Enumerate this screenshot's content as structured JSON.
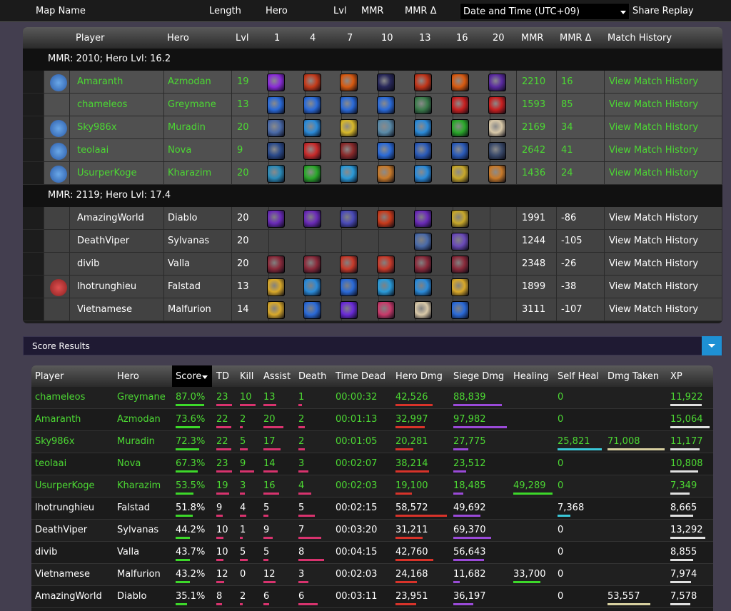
{
  "topbar": {
    "map_name": "Map Name",
    "length": "Length",
    "hero": "Hero",
    "lvl": "Lvl",
    "mmr": "MMR",
    "mmr_delta": "MMR Δ",
    "date_select": "Date and Time (UTC+09)",
    "share_replay": "Share Replay"
  },
  "match_table": {
    "columns": [
      "Player",
      "Hero",
      "Lvl",
      "1",
      "4",
      "7",
      "10",
      "13",
      "16",
      "20",
      "MMR",
      "MMR Δ",
      "Match History"
    ],
    "teams": [
      {
        "label": "MMR: 2010; Hero Lvl: 16.2",
        "winner": true,
        "players": [
          {
            "player": "Amaranth",
            "hero": "Azmodan",
            "lvl": "19",
            "mmr": "2210",
            "mmr_delta": "16",
            "history": "View Match History",
            "badge": "hex-blue-badge",
            "talents": [
              "#8a2bd8",
              "#c43a1a",
              "#d85a10",
              "#28285a",
              "#c03418",
              "#d85a10",
              "#5a2aa0"
            ]
          },
          {
            "player": "chameleos",
            "hero": "Greymane",
            "lvl": "13",
            "mmr": "1593",
            "mmr_delta": "85",
            "history": "View Match History",
            "badge": "",
            "talents": [
              "#2a6ad8",
              "#2a6ad8",
              "#2a6ad8",
              "#2a6ad8",
              "#3a7a4a",
              "#c82020",
              "#c82020"
            ]
          },
          {
            "player": "Sky986x",
            "hero": "Muradin",
            "lvl": "20",
            "mmr": "2169",
            "mmr_delta": "34",
            "history": "View Match History",
            "badge": "shield-blue-badge",
            "talents": [
              "#4a6aa8",
              "#2a8ad8",
              "#d8b82a",
              "#5a8aa8",
              "#2a8ad8",
              "#2aa82a",
              "#d8c8a8"
            ]
          },
          {
            "player": "teolaai",
            "hero": "Nova",
            "lvl": "9",
            "mmr": "2642",
            "mmr_delta": "41",
            "history": "View Match History",
            "badge": "shield-blue-badge",
            "talents": [
              "#2a4a8a",
              "#c82a2a",
              "#8a2a2a",
              "#2a6ad8",
              "#2a5ab8",
              "#2a5ab8",
              "#3a4a6a"
            ]
          },
          {
            "player": "UsurperKoge",
            "hero": "Kharazim",
            "lvl": "20",
            "mmr": "1436",
            "mmr_delta": "24",
            "history": "View Match History",
            "badge": "shield-blue-badge",
            "talents": [
              "#2a8ab8",
              "#2aa82a",
              "#2a9ad8",
              "#c87a2a",
              "#2a8ad8",
              "#c8a82a",
              "#c87a2a"
            ]
          }
        ]
      },
      {
        "label": "MMR: 2119; Hero Lvl: 17.4",
        "winner": false,
        "players": [
          {
            "player": "AmazingWorld",
            "hero": "Diablo",
            "lvl": "20",
            "mmr": "1991",
            "mmr_delta": "-86",
            "history": "View Match History",
            "badge": "",
            "talents": [
              "#6a2ab8",
              "#6a2ab8",
              "#4a4ab8",
              "#c83a1a",
              "#6a2ab8",
              "#c8a82a"
            ]
          },
          {
            "player": "DeathViper",
            "hero": "Sylvanas",
            "lvl": "20",
            "mmr": "1244",
            "mmr_delta": "-105",
            "history": "View Match History",
            "badge": "",
            "talents": [
              "",
              "",
              "",
              "",
              "#4a6aa8",
              "#6a4ab8"
            ]
          },
          {
            "player": "divib",
            "hero": "Valla",
            "lvl": "20",
            "mmr": "2348",
            "mmr_delta": "-26",
            "history": "View Match History",
            "badge": "",
            "talents": [
              "#8a2a3a",
              "#8a2a3a",
              "#c83a2a",
              "#c83a2a",
              "#8a2a3a",
              "#8a2a3a"
            ]
          },
          {
            "player": "lhotrunghieu",
            "hero": "Falstad",
            "lvl": "13",
            "mmr": "1899",
            "mmr_delta": "-38",
            "history": "View Match History",
            "badge": "red-wings-badge",
            "talents": [
              "#d8a82a",
              "#2a8ad8",
              "#2a6ad8",
              "#2a9ad8",
              "#2a8ad8",
              "#d8a82a"
            ]
          },
          {
            "player": "Vietnamese",
            "hero": "Malfurion",
            "lvl": "14",
            "mmr": "3111",
            "mmr_delta": "-107",
            "history": "View Match History",
            "badge": "",
            "talents": [
              "#d8a82a",
              "#2a6ad8",
              "#6a2ad8",
              "#c83a6a",
              "#d8c8a8",
              "#2a6ad8"
            ]
          }
        ]
      }
    ]
  },
  "score_results": {
    "title": "Score Results",
    "columns": [
      "Player",
      "Hero",
      "Score",
      "TD",
      "Kill",
      "Assist",
      "Death",
      "Time Dead",
      "Hero Dmg",
      "Siege Dmg",
      "Healing",
      "Self Heal",
      "Dmg Taken",
      "XP"
    ],
    "rows": [
      {
        "player": "chameleos",
        "hero": "Greymane",
        "score": "87.0%",
        "td": "23",
        "kill": "10",
        "assist": "13",
        "death": "1",
        "time_dead": "00:00:32",
        "hero_dmg": "42,526",
        "siege_dmg": "88,839",
        "healing": "",
        "self_heal": "0",
        "dmg_taken": "",
        "xp": "11,922",
        "winner": true
      },
      {
        "player": "Amaranth",
        "hero": "Azmodan",
        "score": "73.6%",
        "td": "22",
        "kill": "2",
        "assist": "20",
        "death": "2",
        "time_dead": "00:01:13",
        "hero_dmg": "32,997",
        "siege_dmg": "97,982",
        "healing": "",
        "self_heal": "0",
        "dmg_taken": "",
        "xp": "15,064",
        "winner": true
      },
      {
        "player": "Sky986x",
        "hero": "Muradin",
        "score": "72.3%",
        "td": "22",
        "kill": "5",
        "assist": "17",
        "death": "2",
        "time_dead": "00:01:05",
        "hero_dmg": "20,281",
        "siege_dmg": "27,775",
        "healing": "",
        "self_heal": "25,821",
        "dmg_taken": "71,008",
        "xp": "11,177",
        "winner": true
      },
      {
        "player": "teolaai",
        "hero": "Nova",
        "score": "67.3%",
        "td": "23",
        "kill": "9",
        "assist": "14",
        "death": "3",
        "time_dead": "00:02:07",
        "hero_dmg": "38,214",
        "siege_dmg": "23,512",
        "healing": "",
        "self_heal": "0",
        "dmg_taken": "",
        "xp": "10,808",
        "winner": true
      },
      {
        "player": "UsurperKoge",
        "hero": "Kharazim",
        "score": "53.5%",
        "td": "19",
        "kill": "3",
        "assist": "16",
        "death": "4",
        "time_dead": "00:02:03",
        "hero_dmg": "19,100",
        "siege_dmg": "18,485",
        "healing": "49,289",
        "self_heal": "0",
        "dmg_taken": "",
        "xp": "7,349",
        "winner": true
      },
      {
        "player": "lhotrunghieu",
        "hero": "Falstad",
        "score": "51.8%",
        "td": "9",
        "kill": "4",
        "assist": "5",
        "death": "5",
        "time_dead": "00:02:15",
        "hero_dmg": "58,572",
        "siege_dmg": "49,692",
        "healing": "",
        "self_heal": "7,368",
        "dmg_taken": "",
        "xp": "8,665",
        "winner": false
      },
      {
        "player": "DeathViper",
        "hero": "Sylvanas",
        "score": "44.2%",
        "td": "10",
        "kill": "1",
        "assist": "9",
        "death": "7",
        "time_dead": "00:03:20",
        "hero_dmg": "31,211",
        "siege_dmg": "69,370",
        "healing": "",
        "self_heal": "0",
        "dmg_taken": "",
        "xp": "13,292",
        "winner": false
      },
      {
        "player": "divib",
        "hero": "Valla",
        "score": "43.7%",
        "td": "10",
        "kill": "5",
        "assist": "5",
        "death": "8",
        "time_dead": "00:04:15",
        "hero_dmg": "42,760",
        "siege_dmg": "56,643",
        "healing": "",
        "self_heal": "0",
        "dmg_taken": "",
        "xp": "8,855",
        "winner": false
      },
      {
        "player": "Vietnamese",
        "hero": "Malfurion",
        "score": "43.2%",
        "td": "12",
        "kill": "0",
        "assist": "12",
        "death": "3",
        "time_dead": "00:02:03",
        "hero_dmg": "24,168",
        "siege_dmg": "11,682",
        "healing": "33,700",
        "self_heal": "0",
        "dmg_taken": "",
        "xp": "7,974",
        "winner": false
      },
      {
        "player": "AmazingWorld",
        "hero": "Diablo",
        "score": "35.1%",
        "td": "8",
        "kill": "2",
        "assist": "6",
        "death": "6",
        "time_dead": "00:03:11",
        "hero_dmg": "23,951",
        "siege_dmg": "36,197",
        "healing": "",
        "self_heal": "0",
        "dmg_taken": "53,557",
        "xp": "7,578",
        "winner": false
      }
    ]
  },
  "colors": {
    "win_green": "#4cd833",
    "score_bar": "#3dd82a",
    "td_bar": "#d8336e",
    "hero_dmg_bar": "#d8332a",
    "siege_bar": "#9a4ad8",
    "healing_bar": "#3dd82a",
    "self_heal_bar": "#3ac8d8",
    "dmg_taken_bar": "#d8d0a0",
    "xp_bar": "#e0e0e0"
  }
}
